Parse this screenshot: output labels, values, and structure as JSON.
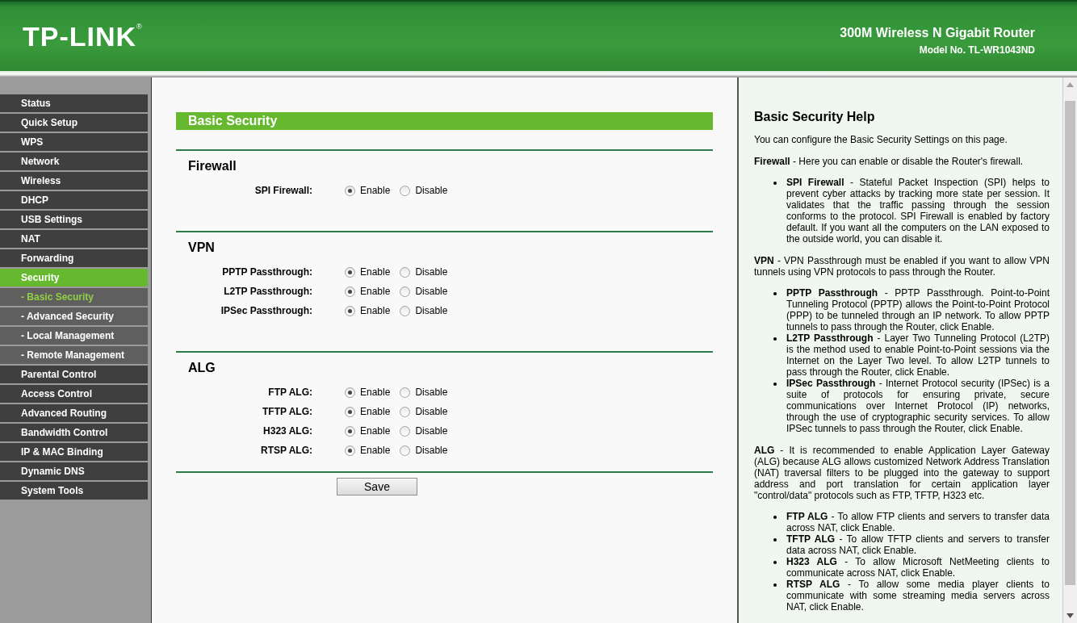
{
  "header": {
    "logo": "TP-LINK",
    "logo_mark": "®",
    "product": "300M Wireless N Gigabit Router",
    "model": "Model No. TL-WR1043ND"
  },
  "sidebar": {
    "items": [
      {
        "label": "Status",
        "kind": "main",
        "selected": false
      },
      {
        "label": "Quick Setup",
        "kind": "main",
        "selected": false
      },
      {
        "label": "WPS",
        "kind": "main",
        "selected": false
      },
      {
        "label": "Network",
        "kind": "main",
        "selected": false
      },
      {
        "label": "Wireless",
        "kind": "main",
        "selected": false
      },
      {
        "label": "DHCP",
        "kind": "main",
        "selected": false
      },
      {
        "label": "USB Settings",
        "kind": "main",
        "selected": false
      },
      {
        "label": "NAT",
        "kind": "main",
        "selected": false
      },
      {
        "label": "Forwarding",
        "kind": "main",
        "selected": false
      },
      {
        "label": "Security",
        "kind": "main",
        "selected": true
      },
      {
        "label": "- Basic Security",
        "kind": "sub",
        "selected": true
      },
      {
        "label": "- Advanced Security",
        "kind": "sub",
        "selected": false
      },
      {
        "label": "- Local Management",
        "kind": "sub",
        "selected": false
      },
      {
        "label": "- Remote Management",
        "kind": "sub",
        "selected": false
      },
      {
        "label": "Parental Control",
        "kind": "main",
        "selected": false
      },
      {
        "label": "Access Control",
        "kind": "main",
        "selected": false
      },
      {
        "label": "Advanced Routing",
        "kind": "main",
        "selected": false
      },
      {
        "label": "Bandwidth Control",
        "kind": "main",
        "selected": false
      },
      {
        "label": "IP & MAC Binding",
        "kind": "main",
        "selected": false
      },
      {
        "label": "Dynamic DNS",
        "kind": "main",
        "selected": false
      },
      {
        "label": "System Tools",
        "kind": "main",
        "selected": false
      }
    ]
  },
  "form": {
    "title": "Basic Security",
    "sections": [
      {
        "title": "Firewall",
        "rows": [
          {
            "label": "SPI Firewall:",
            "options": [
              {
                "label": "Enable",
                "selected": true
              },
              {
                "label": "Disable",
                "selected": false
              }
            ]
          }
        ]
      },
      {
        "title": "VPN",
        "rows": [
          {
            "label": "PPTP Passthrough:",
            "options": [
              {
                "label": "Enable",
                "selected": true
              },
              {
                "label": "Disable",
                "selected": false
              }
            ]
          },
          {
            "label": "L2TP Passthrough:",
            "options": [
              {
                "label": "Enable",
                "selected": true
              },
              {
                "label": "Disable",
                "selected": false
              }
            ]
          },
          {
            "label": "IPSec Passthrough:",
            "options": [
              {
                "label": "Enable",
                "selected": true
              },
              {
                "label": "Disable",
                "selected": false
              }
            ]
          }
        ]
      },
      {
        "title": "ALG",
        "rows": [
          {
            "label": "FTP ALG:",
            "options": [
              {
                "label": "Enable",
                "selected": true
              },
              {
                "label": "Disable",
                "selected": false
              }
            ]
          },
          {
            "label": "TFTP ALG:",
            "options": [
              {
                "label": "Enable",
                "selected": true
              },
              {
                "label": "Disable",
                "selected": false
              }
            ]
          },
          {
            "label": "H323 ALG:",
            "options": [
              {
                "label": "Enable",
                "selected": true
              },
              {
                "label": "Disable",
                "selected": false
              }
            ]
          },
          {
            "label": "RTSP ALG:",
            "options": [
              {
                "label": "Enable",
                "selected": true
              },
              {
                "label": "Disable",
                "selected": false
              }
            ]
          }
        ]
      }
    ],
    "save": "Save"
  },
  "help": {
    "title": "Basic Security Help",
    "blocks": [
      {
        "kind": "para",
        "text": "You can configure the Basic Security Settings on this page."
      },
      {
        "kind": "para",
        "text": "**Firewall** - Here you can enable or disable the Router's firewall."
      },
      {
        "kind": "list",
        "items": [
          "**SPI Firewall** - Stateful Packet Inspection (SPI) helps to prevent cyber attacks by tracking more state per session. It validates that the traffic passing through the session conforms to the protocol. SPI Firewall is enabled by factory default. If you want all the computers on the LAN exposed to the outside world, you can disable it."
        ]
      },
      {
        "kind": "para",
        "text": "**VPN** - VPN Passthrough must be enabled if you want to allow VPN tunnels using VPN protocols to pass through the Router."
      },
      {
        "kind": "list",
        "items": [
          "**PPTP Passthrough** - PPTP Passthrough. Point-to-Point Tunneling Protocol (PPTP) allows the Point-to-Point Protocol (PPP) to be tunneled through an IP network. To allow PPTP tunnels to pass through the Router, click Enable.",
          "**L2TP Passthrough** - Layer Two Tunneling Protocol (L2TP) is the method used to enable Point-to-Point sessions via the Internet on the Layer Two level. To allow L2TP tunnels to pass through the Router, click Enable.",
          "**IPSec Passthrough** - Internet Protocol security (IPSec) is a suite of protocols for ensuring private, secure communications over Internet Protocol (IP) networks, through the use of cryptographic security services. To allow IPSec tunnels to pass through the Router, click Enable."
        ]
      },
      {
        "kind": "para",
        "text": "**ALG** - It is recommended to enable Application Layer Gateway (ALG) because ALG allows customized Network Address Translation (NAT) traversal filters to be plugged into the gateway to support address and port translation for certain application layer \"control/data\" protocols such as FTP, TFTP, H323 etc."
      },
      {
        "kind": "list",
        "items": [
          "**FTP ALG** - To allow FTP clients and servers to transfer data across NAT, click Enable.",
          "**TFTP ALG** - To allow TFTP clients and servers to transfer data across NAT, click Enable.",
          "**H323 ALG** - To allow Microsoft NetMeeting clients to communicate across NAT, click Enable.",
          "**RTSP ALG** - To allow some media player clients to communicate with some streaming media servers across NAT, click Enable."
        ]
      }
    ]
  }
}
